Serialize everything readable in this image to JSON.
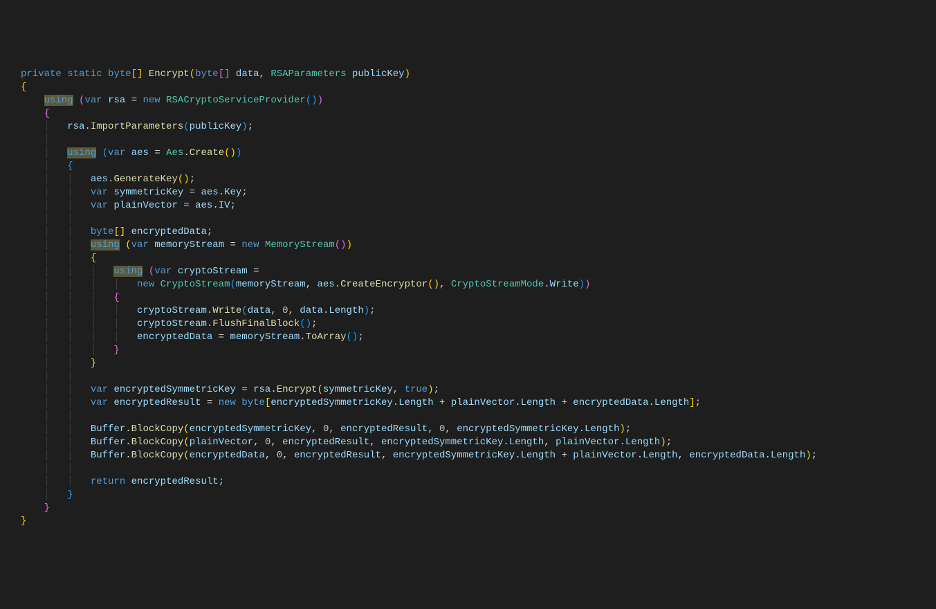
{
  "kw": {
    "private": "private",
    "static": "static",
    "byte": "byte",
    "using": "using",
    "var": "var",
    "new": "new",
    "return": "return",
    "true": "true"
  },
  "types": {
    "RSAParameters": "RSAParameters",
    "RSACryptoServiceProvider": "RSACryptoServiceProvider",
    "Aes": "Aes",
    "MemoryStream": "MemoryStream",
    "CryptoStream": "CryptoStream",
    "CryptoStreamMode": "CryptoStreamMode"
  },
  "fn": {
    "Encrypt": "Encrypt",
    "ImportParameters": "ImportParameters",
    "Create": "Create",
    "GenerateKey": "GenerateKey",
    "CreateEncryptor": "CreateEncryptor",
    "Write": "Write",
    "FlushFinalBlock": "FlushFinalBlock",
    "ToArray": "ToArray",
    "BlockCopy": "BlockCopy"
  },
  "id": {
    "data": "data",
    "publicKey": "publicKey",
    "rsa": "rsa",
    "aes": "aes",
    "symmetricKey": "symmetricKey",
    "Key": "Key",
    "plainVector": "plainVector",
    "IV": "IV",
    "encryptedData": "encryptedData",
    "memoryStream": "memoryStream",
    "cryptoStream": "cryptoStream",
    "Length": "Length",
    "encryptedSymmetricKey": "encryptedSymmetricKey",
    "encryptedResult": "encryptedResult",
    "Buffer": "Buffer"
  },
  "num": {
    "zero": "0"
  }
}
